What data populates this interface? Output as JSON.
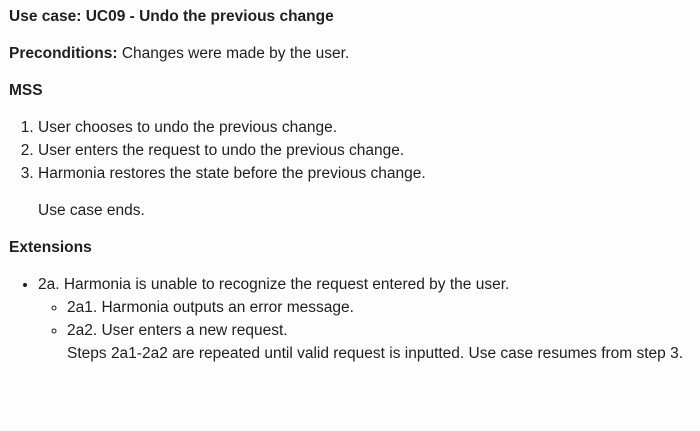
{
  "use_case": {
    "title": "Use case: UC09 - Undo the previous change",
    "preconditions_label": "Preconditions:",
    "preconditions_text": " Changes were made by the user."
  },
  "mss": {
    "heading": "MSS",
    "steps": [
      "User chooses to undo the previous change.",
      "User enters the request to undo the previous change.",
      "Harmonia restores the state before the previous change."
    ],
    "end_text": "Use case ends."
  },
  "extensions": {
    "heading": "Extensions",
    "items": [
      {
        "text": "2a. Harmonia is unable to recognize the request entered by the user.",
        "sub": [
          "2a1. Harmonia outputs an error message.",
          "2a2. User enters a new request."
        ],
        "note": "Steps 2a1-2a2 are repeated until valid request is inputted. Use case resumes from step 3."
      }
    ]
  }
}
